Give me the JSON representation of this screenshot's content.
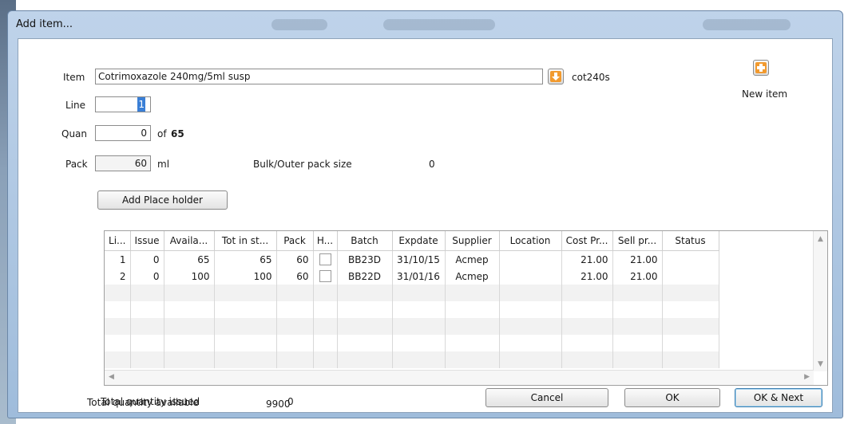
{
  "window": {
    "title": "Add item..."
  },
  "form": {
    "item_label": "Item",
    "item_value": "Cotrimoxazole 240mg/5ml susp",
    "item_code": "cot240s",
    "line_label": "Line",
    "line_value": "1",
    "quan_label": "Quan",
    "quan_value": "0",
    "quan_of": "of",
    "quan_total": "65",
    "pack_label": "Pack",
    "pack_value": "60",
    "pack_unit": "ml",
    "bulk_label": "Bulk/Outer pack size",
    "bulk_value": "0",
    "new_item_label": "New item",
    "add_placeholder_label": "Add Place holder"
  },
  "table": {
    "columns": [
      "Li...",
      "Issue",
      "Availa...",
      "Tot in st...",
      "Pack",
      "H...",
      "Batch",
      "Expdate",
      "Supplier",
      "Location",
      "Cost Pr...",
      "Sell pr...",
      "Status"
    ],
    "rows": [
      {
        "line": "1",
        "issue": "0",
        "available": "65",
        "tot_in_stock": "65",
        "pack": "60",
        "hold": false,
        "batch": "BB23D",
        "expdate": "31/10/15",
        "supplier": "Acmep",
        "location": "",
        "cost_price": "21.00",
        "sell_price": "21.00",
        "status": ""
      },
      {
        "line": "2",
        "issue": "0",
        "available": "100",
        "tot_in_stock": "100",
        "pack": "60",
        "hold": false,
        "batch": "BB22D",
        "expdate": "31/01/16",
        "supplier": "Acmep",
        "location": "",
        "cost_price": "21.00",
        "sell_price": "21.00",
        "status": ""
      }
    ]
  },
  "totals": {
    "issued_label": "Total quantity issued",
    "issued_value": "0",
    "available_label": "Total quantity available",
    "available_value": "9900"
  },
  "buttons": {
    "cancel": "Cancel",
    "ok": "OK",
    "ok_next": "OK & Next"
  },
  "icons": {
    "lookup": "down-arrow-icon",
    "new_item": "plus-icon",
    "accent": "#f29a2e"
  }
}
